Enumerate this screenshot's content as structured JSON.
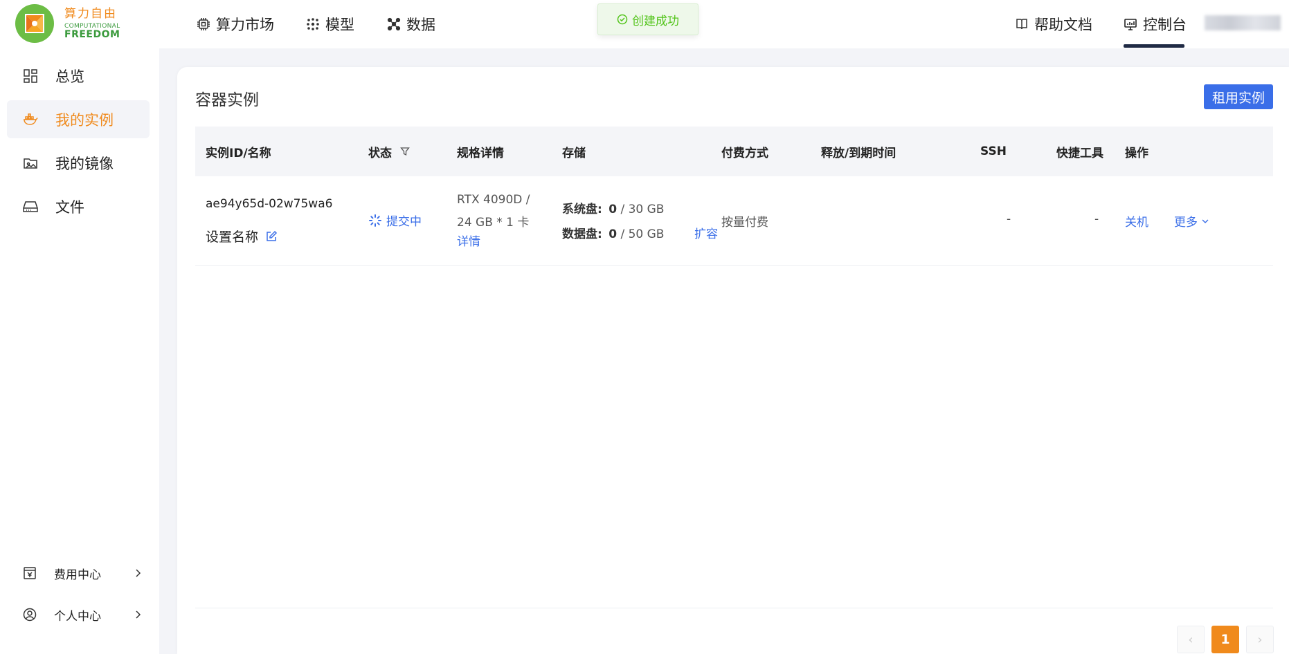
{
  "brand": {
    "cn": "算力自由",
    "en_line1": "COMPUTATIONAL",
    "en_line2": "FREEDOM",
    "colors": {
      "orange": "#f08a1c",
      "green": "#3a9a3c"
    }
  },
  "topnav": {
    "items": [
      {
        "label": "算力市场",
        "icon": "chip-icon"
      },
      {
        "label": "模型",
        "icon": "model-icon"
      },
      {
        "label": "数据",
        "icon": "data-nodes-icon"
      }
    ],
    "right": [
      {
        "label": "帮助文档",
        "icon": "book-icon"
      },
      {
        "label": "控制台",
        "icon": "monitor-icon",
        "active": true
      }
    ]
  },
  "toast": {
    "text": "创建成功",
    "icon": "check-circle-icon",
    "color": "#52c41a"
  },
  "sidebar": {
    "items": [
      {
        "label": "总览",
        "icon": "dashboard-icon"
      },
      {
        "label": "我的实例",
        "icon": "container-icon",
        "active": true
      },
      {
        "label": "我的镜像",
        "icon": "image-folder-icon"
      },
      {
        "label": "文件",
        "icon": "storage-icon"
      }
    ],
    "bottom": [
      {
        "label": "费用中心",
        "icon": "billing-icon"
      },
      {
        "label": "个人中心",
        "icon": "user-circle-icon"
      }
    ]
  },
  "main": {
    "title": "容器实例",
    "rent_button": "租用实例",
    "accent": "#3a6ee8",
    "columns": [
      "实例ID/名称",
      "状态",
      "规格详情",
      "存储",
      "付费方式",
      "释放/到期时间",
      "SSH",
      "快捷工具",
      "操作"
    ],
    "rows": [
      {
        "id": "ae94y65d-02w75wa6",
        "set_name": "设置名称",
        "status": "提交中",
        "spec_line1": "RTX 4090D /",
        "spec_line2": "24 GB * 1 卡",
        "spec_detail": "详情",
        "sys_disk_label": "系统盘:",
        "sys_disk_used": "0",
        "sys_disk_total": "/ 30 GB",
        "data_disk_label": "数据盘:",
        "data_disk_used": "0",
        "data_disk_total": "/ 50 GB",
        "expand": "扩容",
        "billing": "按量付费",
        "release_time": "",
        "ssh": "-",
        "tools": "-",
        "action_shutdown": "关机",
        "action_more": "更多"
      }
    ]
  },
  "pagination": {
    "prev": "‹",
    "current": "1",
    "next": "›"
  }
}
